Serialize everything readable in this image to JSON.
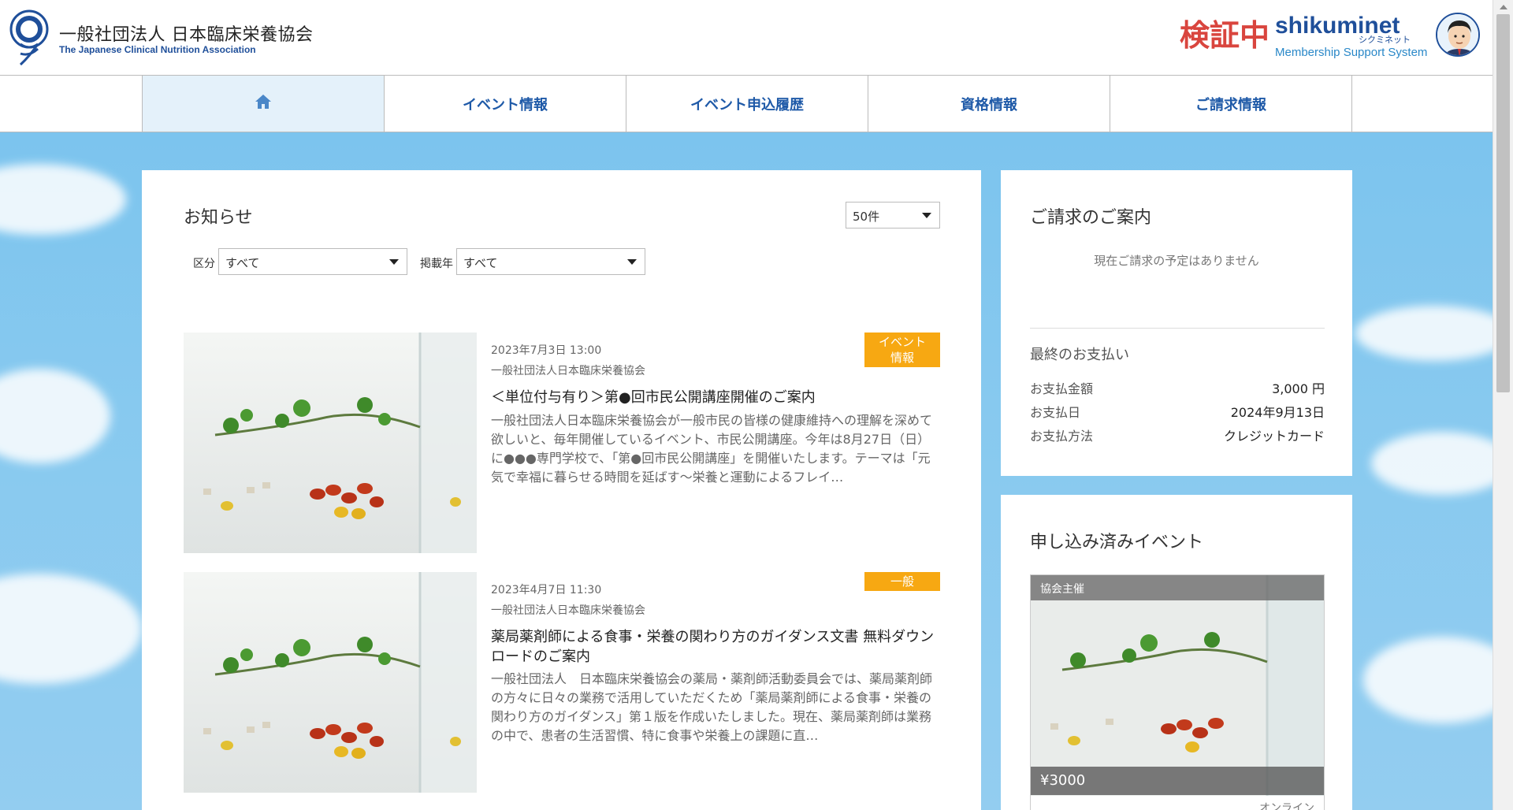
{
  "header": {
    "org_name": "一般社団法人 日本臨床栄養協会",
    "org_name_en": "The Japanese Clinical Nutrition Association",
    "verify_label": "検証中",
    "system_brand": "shikuminet",
    "system_brand_kana": "シクミネット",
    "system_tagline": "Membership Support System"
  },
  "nav": {
    "items": [
      {
        "label": "",
        "icon": "home-icon"
      },
      {
        "label": "イベント情報"
      },
      {
        "label": "イベント申込履歴"
      },
      {
        "label": "資格情報"
      },
      {
        "label": "ご請求情報"
      }
    ]
  },
  "notices": {
    "title": "お知らせ",
    "count_select": "50件",
    "category_label": "区分",
    "category_value": "すべて",
    "year_label": "掲載年",
    "year_value": "すべて",
    "items": [
      {
        "date": "2023年7月3日 13:00",
        "org": "一般社団法人日本臨床栄養協会",
        "badge": "イベント\n情報",
        "title": "＜単位付与有り＞第●回市民公開講座開催のご案内",
        "body": "一般社団法人日本臨床栄養協会が一般市民の皆様の健康維持への理解を深めて欲しいと、毎年開催しているイベント、市民公開講座。今年は8月27日（日）に●●●専門学校で、「第●回市民公開講座」を開催いたします。テーマは「元気で幸福に暮らせる時間を延ばす〜栄養と運動によるフレイ…"
      },
      {
        "date": "2023年4月7日 11:30",
        "org": "一般社団法人日本臨床栄養協会",
        "badge": "一般",
        "title": "薬局薬剤師による食事・栄養の関わり方のガイダンス文書 無料ダウンロードのご案内",
        "body": "一般社団法人　日本臨床栄養協会の薬局・薬剤師活動委員会では、薬局薬剤師の方々に日々の業務で活用していただくため「薬局薬剤師による食事・栄養の関わり方のガイダンス」第１版を作成いたしました。現在、薬局薬剤師は業務の中で、患者の生活習慣、特に食事や栄養上の課題に直…"
      }
    ]
  },
  "billing": {
    "title": "ご請求のご案内",
    "empty_message": "現在ご請求の予定はありません",
    "last_payment_title": "最終のお支払い",
    "amount_label": "お支払金額",
    "amount_value": "3,000 円",
    "date_label": "お支払日",
    "date_value": "2024年9月13日",
    "method_label": "お支払方法",
    "method_value": "クレジットカード"
  },
  "events": {
    "title": "申し込み済みイベント",
    "card": {
      "category": "協会主催",
      "price": "¥3000",
      "mode": "オンライン"
    }
  }
}
